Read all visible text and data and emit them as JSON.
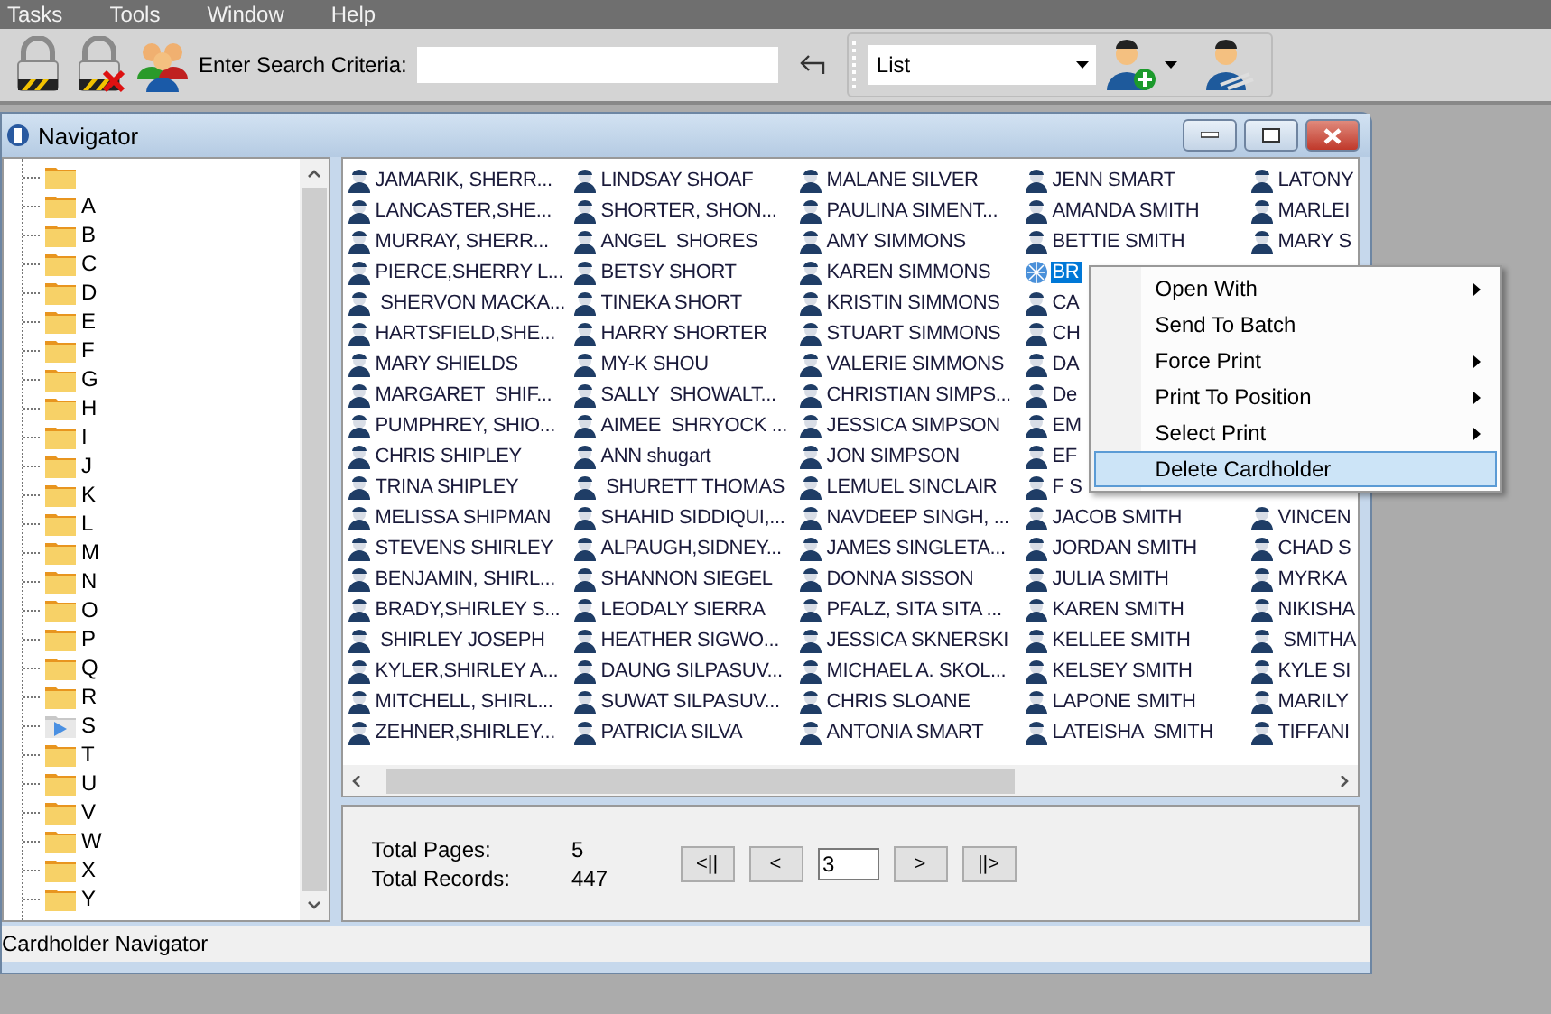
{
  "menu_bar": [
    "Tasks",
    "Tools",
    "Window",
    "Help"
  ],
  "toolbar": {
    "search_label": "Enter Search Criteria:",
    "view_select": "List"
  },
  "window": {
    "title": "Navigator"
  },
  "tree": {
    "folders": [
      {
        "selected": false
      },
      {
        "label": "A",
        "selected": false
      },
      {
        "label": "B",
        "selected": false
      },
      {
        "label": "C",
        "selected": false
      },
      {
        "label": "D",
        "selected": false
      },
      {
        "label": "E",
        "selected": false
      },
      {
        "label": "F",
        "selected": false
      },
      {
        "label": "G",
        "selected": false
      },
      {
        "label": "H",
        "selected": false
      },
      {
        "label": "I",
        "selected": false
      },
      {
        "label": "J",
        "selected": false
      },
      {
        "label": "K",
        "selected": false
      },
      {
        "label": "L",
        "selected": false
      },
      {
        "label": "M",
        "selected": false
      },
      {
        "label": "N",
        "selected": false
      },
      {
        "label": "O",
        "selected": false
      },
      {
        "label": "P",
        "selected": false
      },
      {
        "label": "Q",
        "selected": false
      },
      {
        "label": "R",
        "selected": false
      },
      {
        "label": "S",
        "selected": true
      },
      {
        "label": "T",
        "selected": false
      },
      {
        "label": "U",
        "selected": false
      },
      {
        "label": "V",
        "selected": false
      },
      {
        "label": "W",
        "selected": false
      },
      {
        "label": "X",
        "selected": false
      },
      {
        "label": "Y",
        "selected": false
      }
    ]
  },
  "cardholders": {
    "columns": [
      {
        "groups": [
          {
            "items": [
              {
                "name": "JAMARIK, SHERR...",
                "selected": false
              },
              {
                "name": "LANCASTER,SHE...",
                "selected": false
              },
              {
                "name": "MURRAY, SHERR...",
                "selected": false
              },
              {
                "name": "PIERCE,SHERRY L...",
                "selected": false
              },
              {
                "name": " SHERVON MACKA...",
                "selected": false
              },
              {
                "name": "HARTSFIELD,SHE...",
                "selected": false
              },
              {
                "name": "MARY SHIELDS",
                "selected": false
              },
              {
                "name": "MARGARET  SHIF...",
                "selected": false
              },
              {
                "name": "PUMPHREY, SHIO...",
                "selected": false
              },
              {
                "name": "CHRIS SHIPLEY",
                "selected": false
              },
              {
                "name": "TRINA SHIPLEY",
                "selected": false
              },
              {
                "name": "MELISSA SHIPMAN",
                "selected": false
              },
              {
                "name": "STEVENS SHIRLEY",
                "selected": false
              },
              {
                "name": "BENJAMIN, SHIRL...",
                "selected": false
              },
              {
                "name": "BRADY,SHIRLEY S...",
                "selected": false
              },
              {
                "name": " SHIRLEY JOSEPH",
                "selected": false
              },
              {
                "name": "KYLER,SHIRLEY A...",
                "selected": false
              },
              {
                "name": "MITCHELL, SHIRL...",
                "selected": false
              },
              {
                "name": "ZEHNER,SHIRLEY...",
                "selected": false
              }
            ]
          }
        ]
      },
      {
        "groups": [
          {
            "items": [
              {
                "name": "LINDSAY SHOAF",
                "selected": false
              },
              {
                "name": "SHORTER, SHON...",
                "selected": false
              },
              {
                "name": "ANGEL  SHORES",
                "selected": false
              },
              {
                "name": "BETSY SHORT",
                "selected": false
              },
              {
                "name": "TINEKA SHORT",
                "selected": false
              },
              {
                "name": "HARRY SHORTER",
                "selected": false
              },
              {
                "name": "MY-K SHOU",
                "selected": false
              },
              {
                "name": "SALLY  SHOWALT...",
                "selected": false
              },
              {
                "name": "AIMEE  SHRYOCK ...",
                "selected": false
              },
              {
                "name": "ANN shugart",
                "selected": false
              },
              {
                "name": " SHURETT THOMAS",
                "selected": false
              },
              {
                "name": "SHAHID SIDDIQUI,...",
                "selected": false
              },
              {
                "name": "ALPAUGH,SIDNEY...",
                "selected": false
              },
              {
                "name": "SHANNON SIEGEL",
                "selected": false
              },
              {
                "name": "LEODALY SIERRA",
                "selected": false
              },
              {
                "name": "HEATHER SIGWO...",
                "selected": false
              },
              {
                "name": "DAUNG SILPASUV...",
                "selected": false
              },
              {
                "name": "SUWAT SILPASUV...",
                "selected": false
              },
              {
                "name": "PATRICIA SILVA",
                "selected": false
              }
            ]
          }
        ]
      },
      {
        "groups": [
          {
            "items": [
              {
                "name": "MALANE SILVER",
                "selected": false
              },
              {
                "name": "PAULINA SIMENT...",
                "selected": false
              },
              {
                "name": "AMY SIMMONS",
                "selected": false
              },
              {
                "name": "KAREN SIMMONS",
                "selected": false
              },
              {
                "name": "KRISTIN SIMMONS",
                "selected": false
              },
              {
                "name": "STUART SIMMONS",
                "selected": false
              },
              {
                "name": "VALERIE SIMMONS",
                "selected": false
              },
              {
                "name": "CHRISTIAN SIMPS...",
                "selected": false
              },
              {
                "name": "JESSICA SIMPSON",
                "selected": false
              },
              {
                "name": "JON SIMPSON",
                "selected": false
              },
              {
                "name": "LEMUEL SINCLAIR",
                "selected": false
              },
              {
                "name": "NAVDEEP SINGH, ...",
                "selected": false
              },
              {
                "name": "JAMES SINGLETA...",
                "selected": false
              },
              {
                "name": "DONNA SISSON",
                "selected": false
              },
              {
                "name": "PFALZ, SITA SITA ...",
                "selected": false
              },
              {
                "name": "JESSICA SKNERSKI",
                "selected": false
              },
              {
                "name": "MICHAEL A. SKOL...",
                "selected": false
              },
              {
                "name": "CHRIS SLOANE",
                "selected": false
              },
              {
                "name": "ANTONIA SMART",
                "selected": false
              }
            ]
          }
        ]
      },
      {
        "groups": [
          {
            "items": [
              {
                "name": "JENN SMART",
                "selected": false
              },
              {
                "name": "AMANDA SMITH",
                "selected": false
              },
              {
                "name": "BETTIE SMITH",
                "selected": false
              },
              {
                "name": "BR",
                "selected": true
              },
              {
                "name": "CA",
                "selected": false
              },
              {
                "name": "CH",
                "selected": false
              },
              {
                "name": "DA",
                "selected": false
              },
              {
                "name": "De",
                "selected": false
              },
              {
                "name": "EM",
                "selected": false
              },
              {
                "name": "EF",
                "selected": false
              },
              {
                "name": "F S",
                "selected": false
              },
              {
                "name": "JACOB SMITH",
                "selected": false
              },
              {
                "name": "JORDAN SMITH",
                "selected": false
              },
              {
                "name": "JULIA SMITH",
                "selected": false
              },
              {
                "name": "KAREN SMITH",
                "selected": false
              },
              {
                "name": "KELLEE SMITH",
                "selected": false
              },
              {
                "name": "KELSEY SMITH",
                "selected": false
              },
              {
                "name": "LAPONE SMITH",
                "selected": false
              },
              {
                "name": "LATEISHA  SMITH",
                "selected": false
              }
            ]
          }
        ]
      },
      {
        "groups": [
          {
            "items": [
              {
                "name": "LATONY",
                "selected": false
              },
              {
                "name": "MARLEI",
                "selected": false
              },
              {
                "name": "MARY S",
                "selected": false
              }
            ]
          },
          {
            "items": [
              {
                "name": "VINCEN",
                "selected": false
              },
              {
                "name": "CHAD S",
                "selected": false
              },
              {
                "name": "MYRKA",
                "selected": false
              },
              {
                "name": "NIKISHA",
                "selected": false
              },
              {
                "name": " SMITHA",
                "selected": false
              },
              {
                "name": "KYLE SI",
                "selected": false
              },
              {
                "name": "MARILY",
                "selected": false
              },
              {
                "name": "TIFFANI",
                "selected": false
              }
            ]
          }
        ]
      }
    ]
  },
  "context_menu": [
    {
      "label": "Open With",
      "submenu": true,
      "selected": false
    },
    {
      "label": "Send To Batch",
      "submenu": false,
      "selected": false
    },
    {
      "label": "Force Print",
      "submenu": true,
      "selected": false
    },
    {
      "label": "Print To Position",
      "submenu": true,
      "selected": false
    },
    {
      "label": "Select Print",
      "submenu": true,
      "selected": false
    },
    {
      "label": "Delete Cardholder",
      "submenu": false,
      "selected": true
    }
  ],
  "pager": {
    "total_pages_label": "Total Pages:",
    "total_pages": "5",
    "total_records_label": "Total Records:",
    "total_records": "447",
    "first": "<||",
    "prev": "<",
    "page": "3",
    "next": ">",
    "last": "||>"
  },
  "status_bar": "Cardholder Navigator"
}
